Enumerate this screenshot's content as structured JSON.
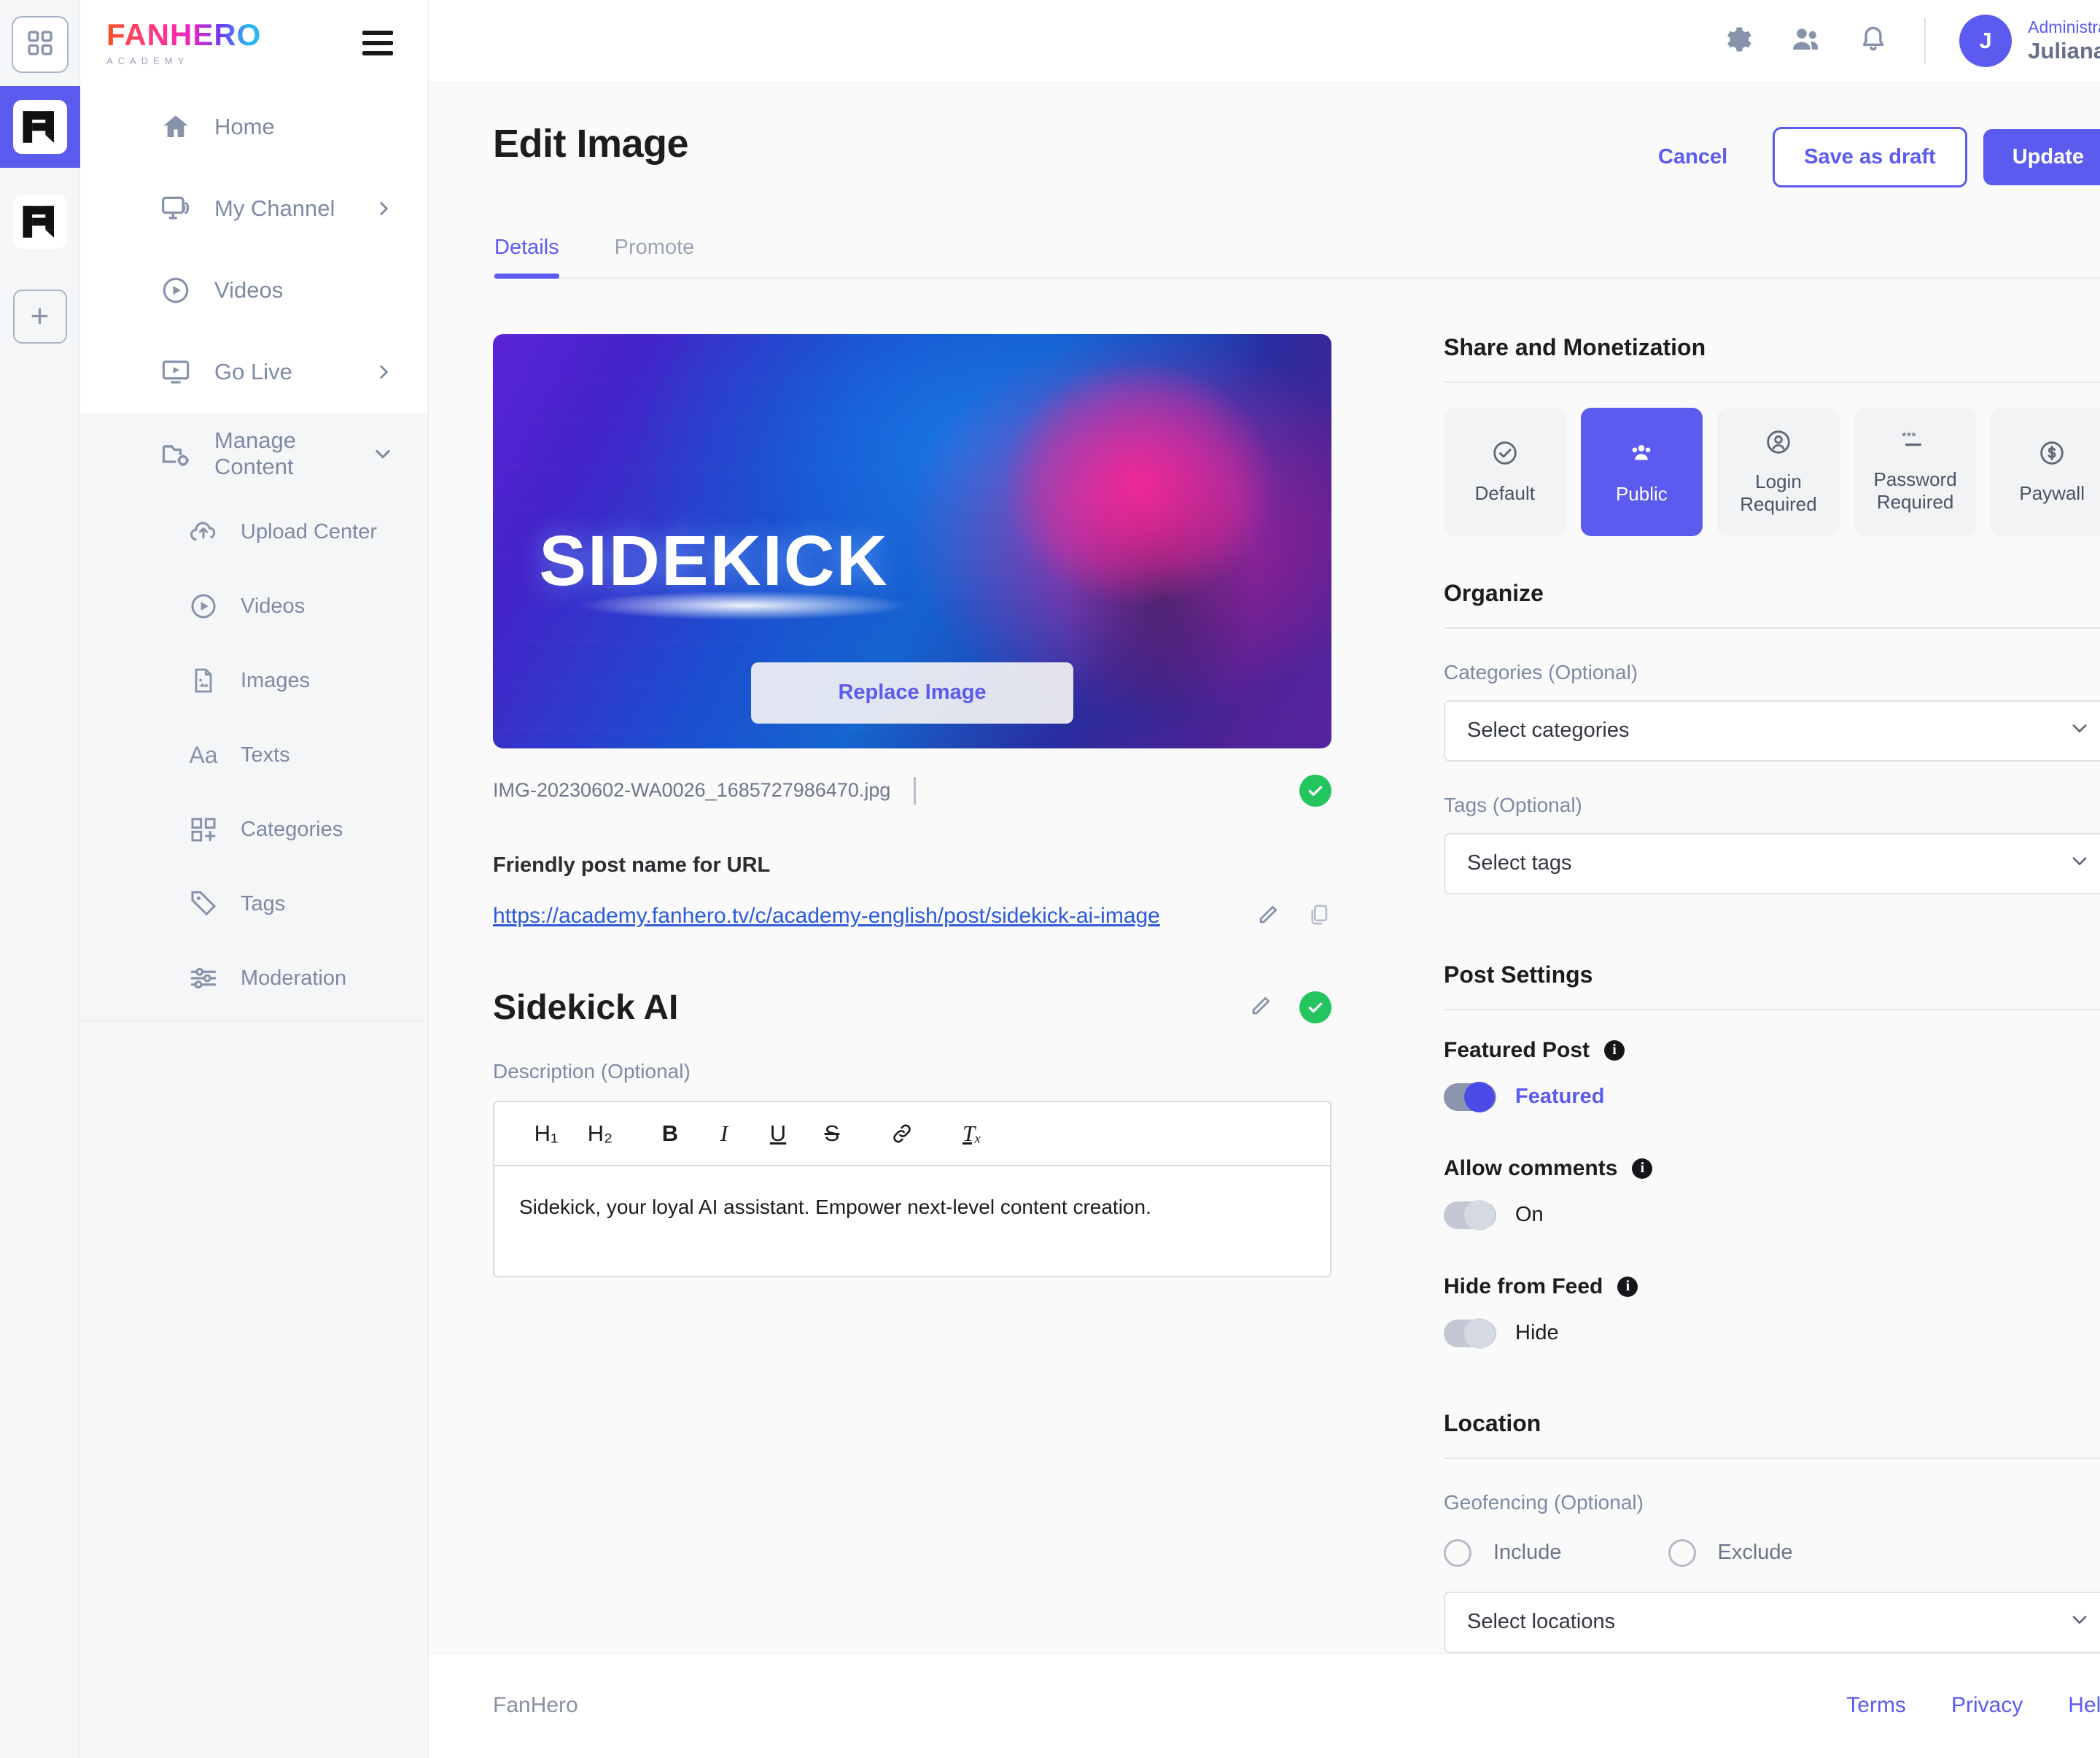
{
  "rail": {
    "grid_button": "grid-icon",
    "workspaces": [
      {
        "name": "FanHero Academy",
        "active": true
      },
      {
        "name": "FanHero",
        "active": false
      }
    ],
    "add_label": "+"
  },
  "sidebar": {
    "brand": {
      "main": "FANHERO",
      "sub": "ACADEMY"
    },
    "menu_toggle": "hamburger-icon",
    "items": [
      {
        "label": "Home",
        "icon": "home-icon",
        "chevron": ""
      },
      {
        "label": "My Channel",
        "icon": "channel-icon",
        "chevron": "›"
      },
      {
        "label": "Videos",
        "icon": "play-circle-icon",
        "chevron": ""
      },
      {
        "label": "Go Live",
        "icon": "live-screen-icon",
        "chevron": "›"
      },
      {
        "label": "Manage Content",
        "icon": "folder-gear-icon",
        "chevron": "⌄"
      }
    ],
    "sub_items": [
      {
        "label": "Upload Center",
        "icon": "cloud-upload-icon"
      },
      {
        "label": "Videos",
        "icon": "play-circle-icon"
      },
      {
        "label": "Images",
        "icon": "image-file-icon"
      },
      {
        "label": "Texts",
        "icon": "text-aa-icon"
      },
      {
        "label": "Categories",
        "icon": "category-grid-plus-icon"
      },
      {
        "label": "Tags",
        "icon": "tag-icon"
      },
      {
        "label": "Moderation",
        "icon": "sliders-icon"
      }
    ]
  },
  "topbar": {
    "icons": [
      "gear-icon",
      "people-icon",
      "bell-icon"
    ],
    "user": {
      "initial": "J",
      "role": "Administrator",
      "name": "Juliana",
      "chevron": "⌄"
    }
  },
  "page": {
    "title": "Edit Image",
    "actions": {
      "cancel": "Cancel",
      "save_draft": "Save as draft",
      "update": "Update"
    },
    "tabs": [
      {
        "label": "Details",
        "active": true
      },
      {
        "label": "Promote",
        "active": false
      }
    ]
  },
  "image_block": {
    "overlay_word": "SIDEKICK",
    "replace_label": "Replace Image",
    "filename": "IMG-20230602-WA0026_1685727986470.jpg",
    "status_icon": "check-circle-icon"
  },
  "url_block": {
    "label": "Friendly post name for URL",
    "url": "https://academy.fanhero.tv/c/academy-english/post/sidekick-ai-image",
    "edit_icon": "pencil-icon",
    "copy_icon": "copy-icon"
  },
  "post": {
    "title": "Sidekick AI",
    "edit_icon": "pencil-icon",
    "status_icon": "check-circle-icon",
    "description_label": "Description (Optional)",
    "description": "Sidekick, your loyal AI assistant. Empower next-level content creation.",
    "toolbar": [
      "H₁",
      "H₂",
      "B",
      "I",
      "U",
      "S",
      "🔗",
      "Tₓ"
    ]
  },
  "share": {
    "title": "Share and Monetization",
    "options": [
      {
        "label": "Default",
        "icon": "check-circle-outline-icon",
        "active": false
      },
      {
        "label": "Public",
        "icon": "group-icon",
        "active": true
      },
      {
        "label": "Login Required",
        "icon": "user-circle-icon",
        "active": false
      },
      {
        "label": "Password Required",
        "icon": "asterisks-icon",
        "active": false
      },
      {
        "label": "Paywall",
        "icon": "dollar-circle-icon",
        "active": false
      }
    ]
  },
  "organize": {
    "title": "Organize",
    "categories_label": "Categories (Optional)",
    "categories_value": "Select categories",
    "tags_label": "Tags (Optional)",
    "tags_value": "Select tags",
    "chevron": "⌄"
  },
  "post_settings": {
    "title": "Post Settings",
    "featured": {
      "label": "Featured Post",
      "state_text": "Featured",
      "on": true
    },
    "comments": {
      "label": "Allow comments",
      "state_text": "On",
      "on": false
    },
    "hide_feed": {
      "label": "Hide from Feed",
      "state_text": "Hide",
      "on": false
    },
    "info_glyph": "i"
  },
  "location": {
    "title": "Location",
    "geofencing_label": "Geofencing (Optional)",
    "include_label": "Include",
    "exclude_label": "Exclude",
    "locations_value": "Select locations",
    "chevron": "⌄"
  },
  "footer": {
    "brand": "FanHero",
    "links": [
      "Terms",
      "Privacy",
      "Help"
    ]
  },
  "colors": {
    "accent": "#5b5bef",
    "success": "#24c55e",
    "muted": "#7e8aa3"
  }
}
